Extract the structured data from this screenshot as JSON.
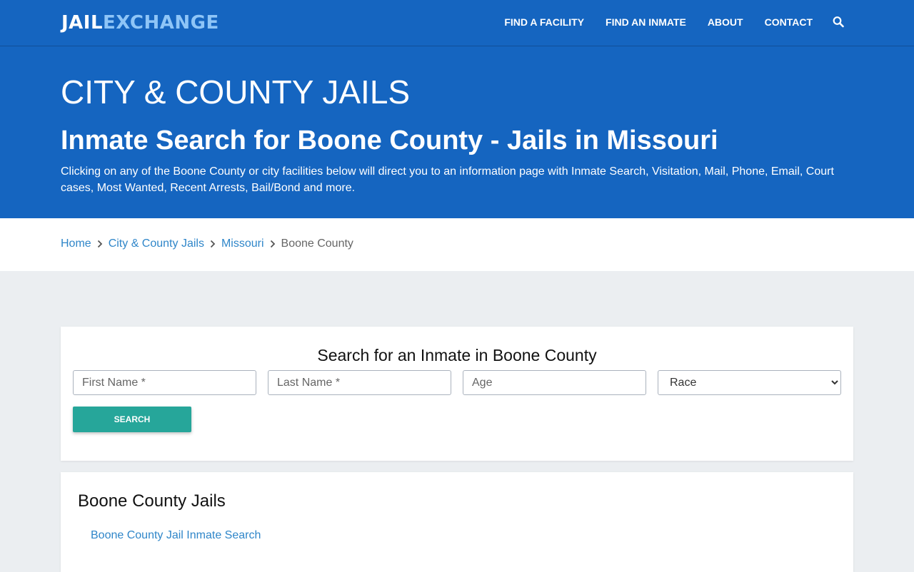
{
  "header": {
    "logo_part1": "JAIL",
    "logo_part2": "EXCHANGE",
    "nav": [
      {
        "label": "FIND A FACILITY"
      },
      {
        "label": "FIND AN INMATE"
      },
      {
        "label": "ABOUT"
      },
      {
        "label": "CONTACT"
      }
    ],
    "search_icon": "search-icon"
  },
  "hero": {
    "title": "CITY & COUNTY JAILS",
    "subtitle": "Inmate Search for Boone County - Jails in Missouri",
    "description": "Clicking on any of the Boone County or city facilities below will direct you to an information page with Inmate Search, Visitation, Mail, Phone, Email, Court cases, Most Wanted, Recent Arrests, Bail/Bond and more."
  },
  "breadcrumb": {
    "items": [
      {
        "label": "Home"
      },
      {
        "label": "City & County Jails"
      },
      {
        "label": "Missouri"
      }
    ],
    "current": "Boone County"
  },
  "search_form": {
    "title": "Search for an Inmate in Boone County",
    "first_name_placeholder": "First Name *",
    "last_name_placeholder": "Last Name *",
    "age_placeholder": "Age",
    "race_selected": "Race",
    "button_label": "SEARCH"
  },
  "jails": {
    "title": "Boone County Jails",
    "links": [
      {
        "label": "Boone County Jail Inmate Search"
      }
    ]
  },
  "colors": {
    "brand_blue": "#1565c0",
    "logo_accent": "#8ec5f7",
    "button_teal": "#26a69a",
    "link_blue": "#2f86c9"
  }
}
